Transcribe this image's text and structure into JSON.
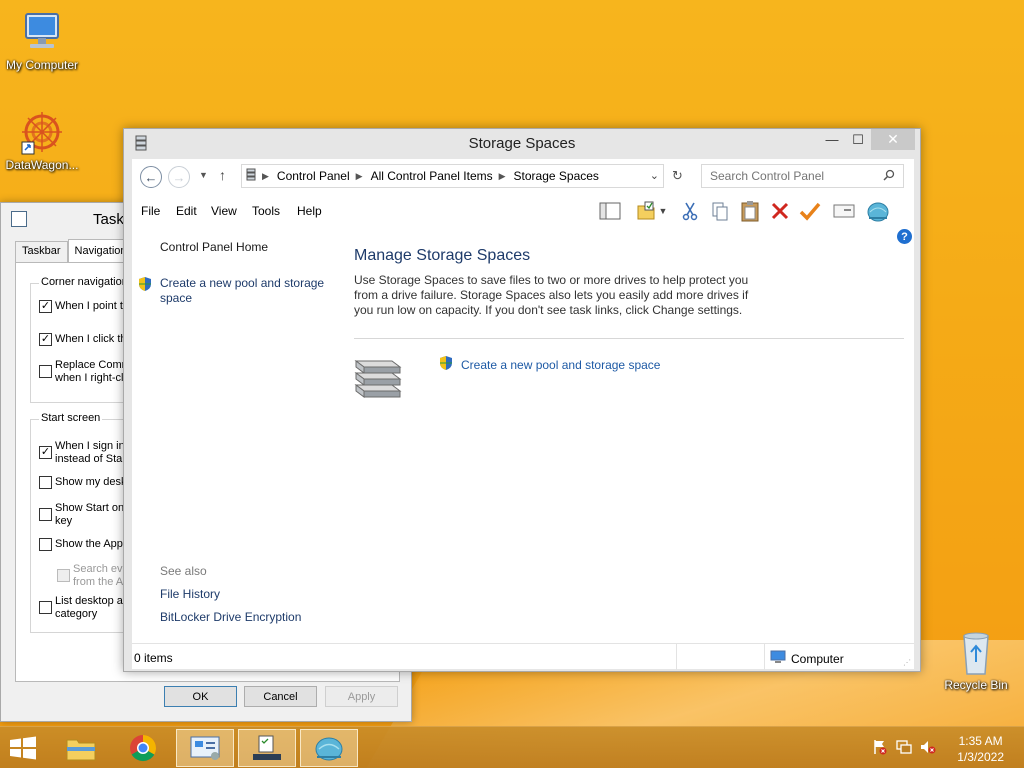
{
  "desktop": {
    "icons": [
      {
        "label": "My Computer"
      },
      {
        "label": "DataWagon..."
      },
      {
        "label": "Recycle Bin"
      }
    ]
  },
  "taskbar_properties": {
    "title": "Task",
    "tabs": [
      "Taskbar",
      "Navigation"
    ],
    "corner_group_label": "Corner navigation",
    "corner_options": [
      {
        "label": "When I point t",
        "checked": true
      },
      {
        "label": "When I click th",
        "checked": true
      },
      {
        "label_line1": "Replace Comm",
        "label_line2": "when I right-cl",
        "checked": false
      }
    ],
    "start_group_label": "Start screen",
    "start_options": [
      {
        "label_line1": "When I sign in",
        "label_line2": "instead of Star",
        "checked": true
      },
      {
        "label_line1": "Show my desk",
        "checked": false
      },
      {
        "label_line1": "Show Start on",
        "label_line2": "key",
        "checked": false
      },
      {
        "label_line1": "Show the Apps",
        "checked": false
      },
      {
        "label_line1": "Search eve",
        "label_line2": "from the A",
        "checked": false,
        "disabled": true
      },
      {
        "label_line1": "List desktop ap",
        "label_line2": "category",
        "checked": false
      }
    ],
    "buttons": {
      "ok": "OK",
      "cancel": "Cancel",
      "apply": "Apply"
    }
  },
  "window": {
    "title": "Storage Spaces",
    "controls": {
      "minimize": "—",
      "maximize": "☐",
      "close": "✕"
    },
    "breadcrumbs": [
      "Control Panel",
      "All Control Panel Items",
      "Storage Spaces"
    ],
    "search_placeholder": "Search Control Panel",
    "menu": [
      "File",
      "Edit",
      "View",
      "Tools",
      "Help"
    ],
    "left_pane": {
      "home": "Control Panel Home",
      "create_pool_line1": "Create a new pool and storage",
      "create_pool_line2": "space",
      "see_also": "See also",
      "see_also_links": [
        "File History",
        "BitLocker Drive Encryption"
      ]
    },
    "main": {
      "heading": "Manage Storage Spaces",
      "description": "Use Storage Spaces to save files to two or more drives to help protect you from a drive failure. Storage Spaces also lets you easily add more drives if you run low on capacity. If you don't see task links, click Change settings.",
      "task_link": "Create a new pool and storage space",
      "help": "?"
    },
    "status": {
      "count": "0 items",
      "location": "Computer"
    }
  },
  "clock": {
    "time": "1:35 AM",
    "date": "1/3/2022"
  },
  "colors": {
    "accent_link": "#1e5aa5",
    "wallpaper": "#f5ab17",
    "heading": "#1e3b6a"
  }
}
